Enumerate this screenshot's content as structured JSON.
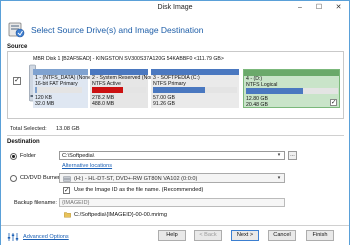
{
  "window": {
    "title": "Disk Image"
  },
  "header": {
    "title": "Select Source Drive(s) and Image Destination"
  },
  "source": {
    "section_label": "Source",
    "disk_header": "MBR Disk 1 [B2AF5EAD] - KINGSTON SV300S37A120G 54KABBF0  <111.79 GB>",
    "disk_checked": "✓",
    "partitions": [
      {
        "name": "1 - (NTFS_DATA) (None)",
        "fs": "16-bit FAT Primary",
        "used": "120 KB",
        "total": "32.0 MB",
        "fill": 0.05,
        "color": "#7fa2d0"
      },
      {
        "name": "2 - System Reserved (Nor",
        "fs": "NTFS Active",
        "used": "278.2 MB",
        "total": "488.0 MB",
        "fill": 0.57,
        "color": "#cc1111"
      },
      {
        "name": "3 - SOFTPEDIA (C:)",
        "fs": "NTFS Primary",
        "used": "57.00 GB",
        "total": "91.26 GB",
        "fill": 0.62,
        "color": "#4a78c0"
      },
      {
        "name": "4 - (D:)",
        "fs": "NTFS Logical",
        "used": "12.80 GB",
        "total": "20.48 GB",
        "fill": 0.62,
        "color": "#4a78c0",
        "checked": "✓"
      }
    ],
    "total_label": "Total Selected:",
    "total_value": "13.08 GB"
  },
  "destination": {
    "section_label": "Destination",
    "folder_label": "Folder",
    "folder_path": "C:\\Softpedia\\",
    "browse_label": "...",
    "alt_link": "Alternative locations",
    "cd_label": "CD/DVD Burner",
    "burner_name": "(H:) - HL-DT-ST, DVD+-RW GT80N    VA102 (0:0:0)",
    "imageid_checked": "✓",
    "imageid_label": "Use the Image ID as the file name.  (Recommended)",
    "backup_label": "Backup filename:",
    "backup_placeholder": "{IMAGEID}",
    "path_preview": "C:/Softpedia\\{IMAGEID}-00-00.mrimg"
  },
  "footer": {
    "advanced_link": "Advanced Options",
    "help": "Help",
    "back": "< Back",
    "next": "Next >",
    "cancel": "Cancel",
    "finish": "Finish"
  },
  "icons": {
    "window_minimize": "–",
    "window_maximize": "☐",
    "window_close": "✕",
    "dropdown_arrow": "▾"
  }
}
